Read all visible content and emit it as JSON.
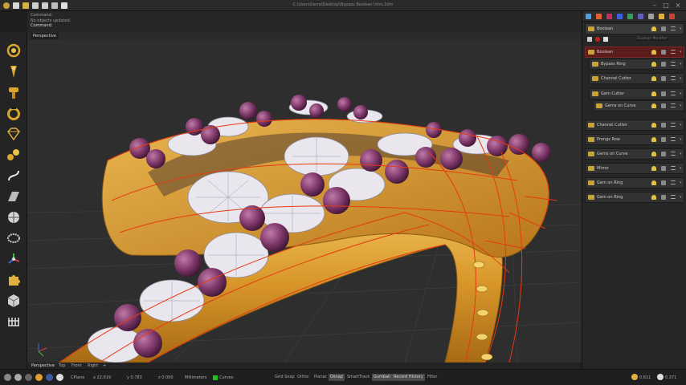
{
  "window": {
    "title": "C:\\Users\\ilarra\\Desktop\\Bypass Boolean Intro.3dm",
    "quick_access_icons": [
      "logo-icon",
      "new-file-icon",
      "open-folder-icon",
      "save-icon",
      "save-as-icon",
      "print-icon",
      "document-icon"
    ]
  },
  "command": {
    "line1": "Command:",
    "line2": "No objects updated.",
    "line3": "Command:"
  },
  "viewport": {
    "active_tab": "Perspective",
    "bottom_tabs": [
      "Perspective",
      "Top",
      "Front",
      "Right",
      "+"
    ]
  },
  "toolbar": {
    "tools": [
      "gem-ring-icon",
      "pendant-icon",
      "bail-icon",
      "ring-shank-icon",
      "diamond-icon",
      "gems-on-curve-icon",
      "curve-icon",
      "surface-icon",
      "sphere-icon",
      "bracelet-icon",
      "gumball-icon",
      "puzzle-icon",
      "cube-icon",
      "prongs-icon"
    ]
  },
  "panel": {
    "header": "Boolean",
    "tooltip": "Boolean Modifier",
    "items": [
      {
        "label": "Boolean",
        "selected": true,
        "indent": 0
      },
      {
        "label": "Bypass Ring",
        "selected": false,
        "indent": 1
      },
      {
        "label": "Channel Cutter",
        "selected": false,
        "indent": 1
      },
      {
        "label": "Gem Cutter",
        "selected": false,
        "indent": 1
      },
      {
        "label": "Gems on Curve",
        "selected": false,
        "indent": 2
      },
      {
        "label": "Channel Cutter",
        "selected": false,
        "indent": 0
      },
      {
        "label": "Prongs Row",
        "selected": false,
        "indent": 0
      },
      {
        "label": "Gems on Curve",
        "selected": false,
        "indent": 0
      },
      {
        "label": "Mirror",
        "selected": false,
        "indent": 0
      },
      {
        "label": "Gem on Ring",
        "selected": false,
        "indent": 0
      },
      {
        "label": "Gem on Ring",
        "selected": false,
        "indent": 0
      }
    ]
  },
  "status": {
    "cplane": "CPlane",
    "x": "x 22.019",
    "y": "y 0.783",
    "z": "z 0.000",
    "units": "Millimeters",
    "layer": "Curves",
    "toggles": [
      {
        "label": "Grid Snap",
        "on": false
      },
      {
        "label": "Ortho",
        "on": false
      },
      {
        "label": "Planar",
        "on": false
      },
      {
        "label": "Osnap",
        "on": true
      },
      {
        "label": "SmartTrack",
        "on": false
      },
      {
        "label": "Gumball",
        "on": true
      },
      {
        "label": "Record History",
        "on": true
      },
      {
        "label": "Filter",
        "on": false
      }
    ],
    "metric1": "0.611",
    "metric2": "0.371"
  },
  "colors": {
    "gold": "#d89a2a",
    "gem_purple": "#7a3a6a",
    "wire_red": "#e03a10",
    "selected_row": "#5c1c1c"
  }
}
